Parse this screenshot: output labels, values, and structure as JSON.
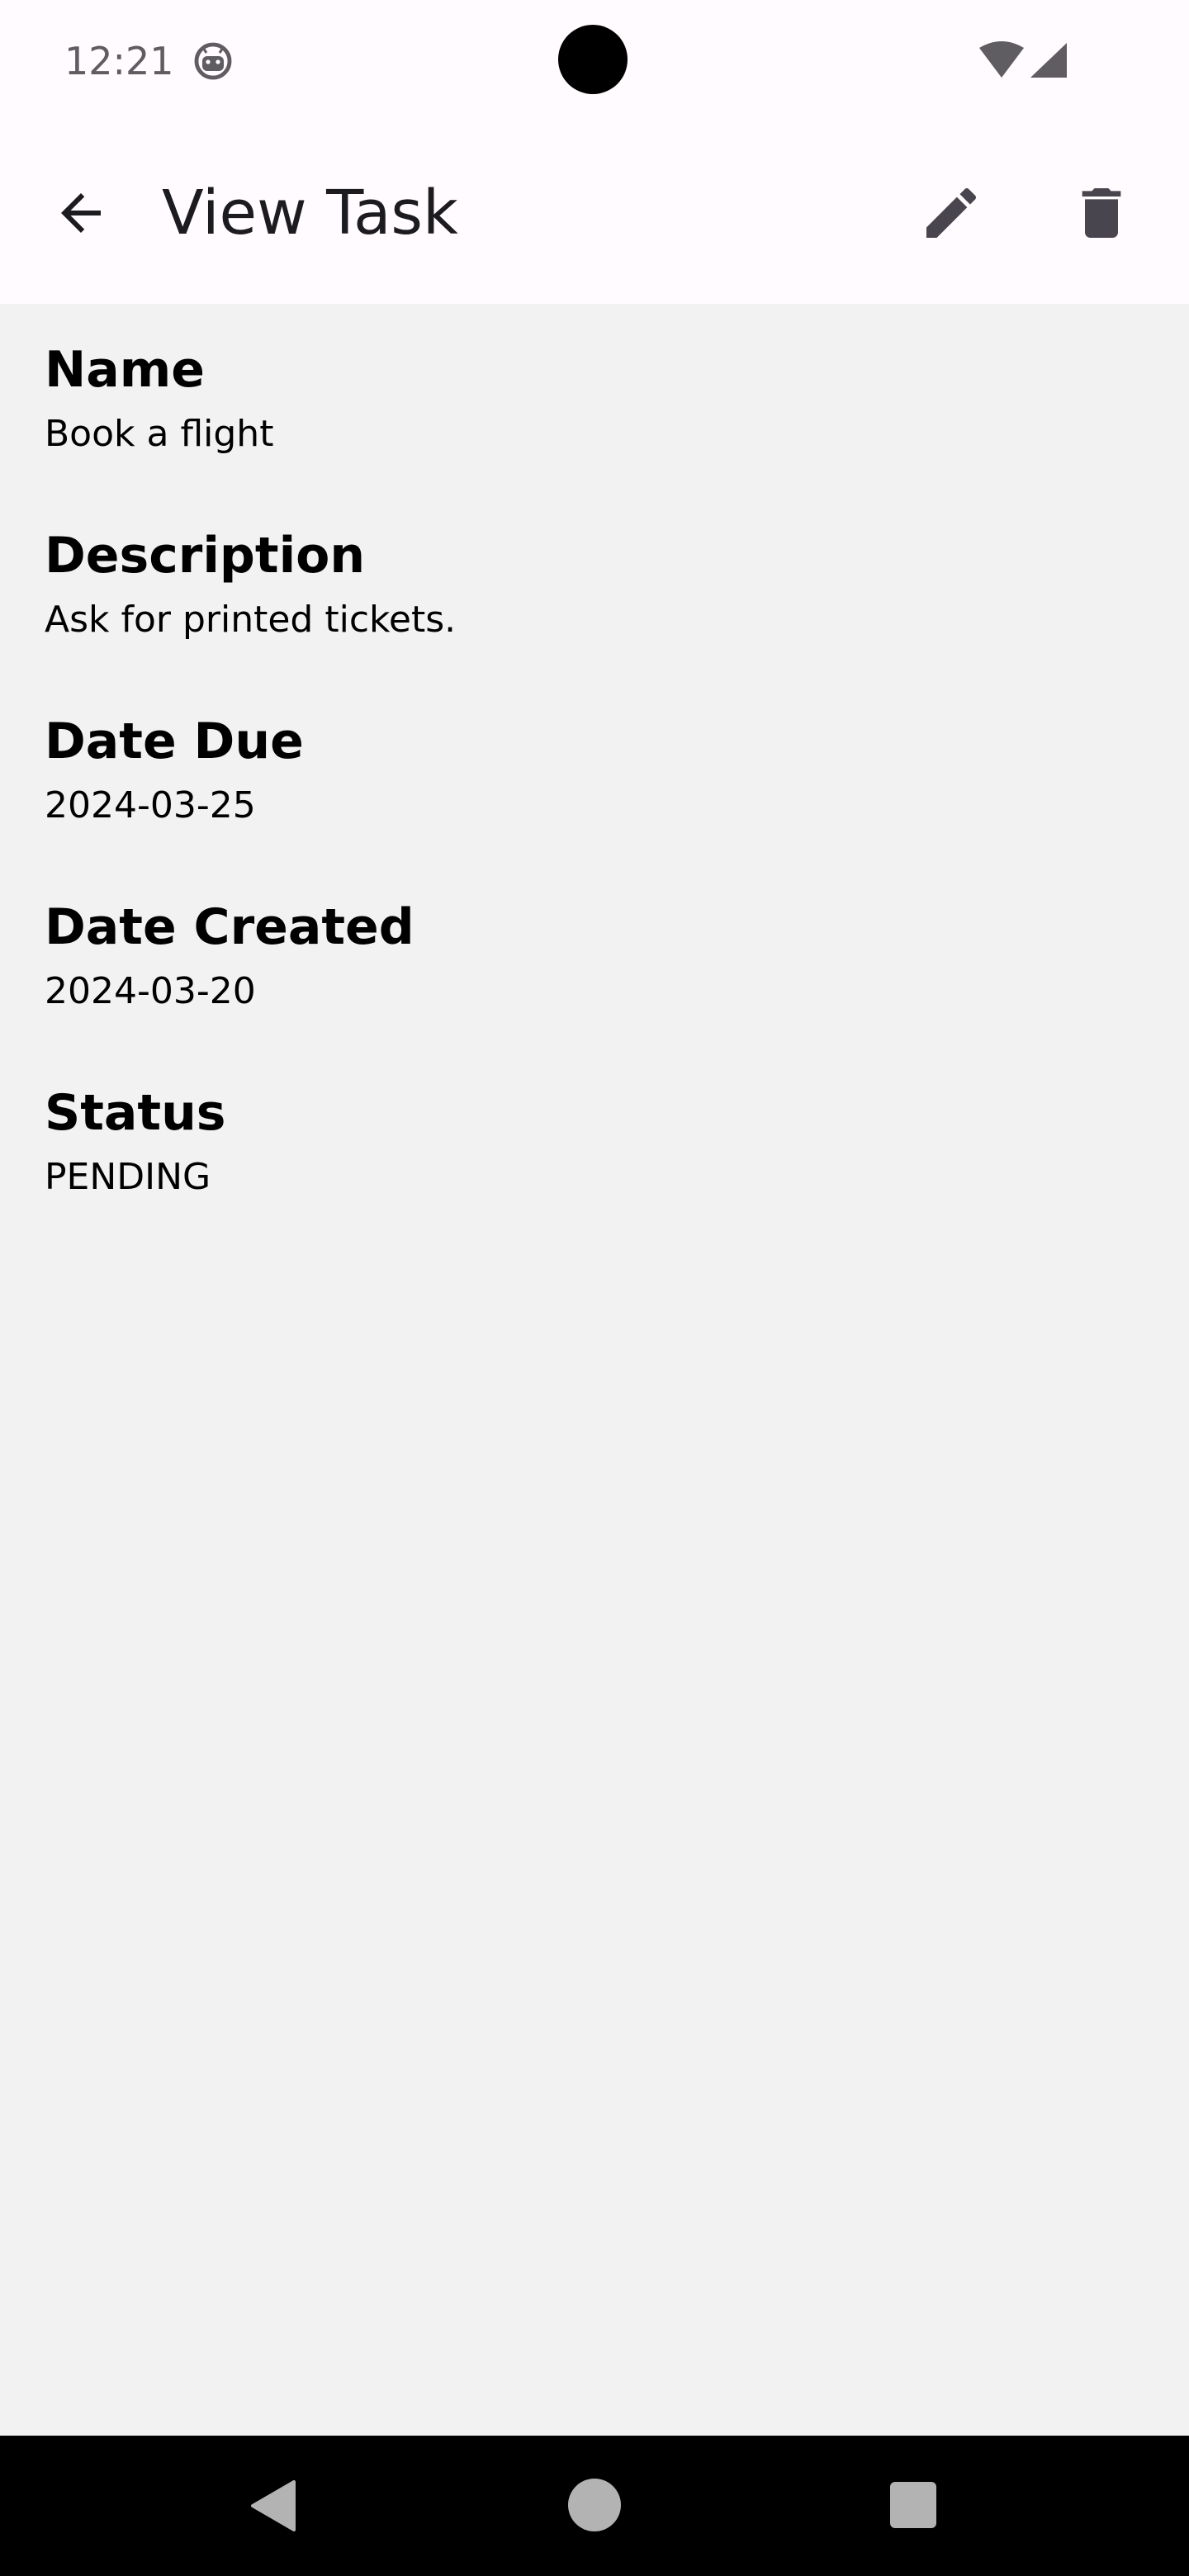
{
  "status_bar": {
    "time": "12:21",
    "app_icon": "android-face-icon",
    "wifi_icon": "wifi-icon",
    "signal_icon": "cell-signal-icon"
  },
  "app_bar": {
    "title": "View Task",
    "back_icon": "arrow-back-icon",
    "edit_icon": "pencil-icon",
    "delete_icon": "trash-icon"
  },
  "task": {
    "name_label": "Name",
    "name_value": "Book a flight",
    "description_label": "Description",
    "description_value": "Ask for printed tickets.",
    "date_due_label": "Date Due",
    "date_due_value": "2024-03-25",
    "date_created_label": "Date Created",
    "date_created_value": "2024-03-20",
    "status_label": "Status",
    "status_value": "PENDING"
  },
  "nav_bar": {
    "back_icon": "nav-back-icon",
    "home_icon": "nav-home-icon",
    "recents_icon": "nav-recents-icon"
  },
  "colors": {
    "app_bar_background": "#fffbfe",
    "content_background": "#f1f2f1",
    "icon_color": "#49454f",
    "nav_bar_background": "#000000"
  }
}
